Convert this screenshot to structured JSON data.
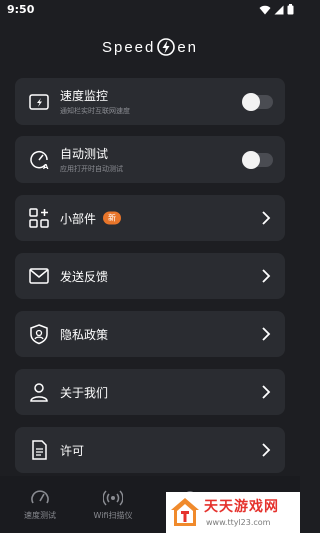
{
  "status_bar": {
    "time": "9:50"
  },
  "header": {
    "logo_left": "Speed",
    "logo_right": "en"
  },
  "settings": [
    {
      "title": "速度监控",
      "subtitle": "通知栏实时互联网速度",
      "control": "toggle",
      "on": false
    },
    {
      "title": "自动测试",
      "subtitle": "应用打开时自动测试",
      "control": "toggle",
      "on": false
    },
    {
      "title": "小部件",
      "badge": "新",
      "control": "chevron"
    },
    {
      "title": "发送反馈",
      "control": "chevron"
    },
    {
      "title": "隐私政策",
      "control": "chevron"
    },
    {
      "title": "关于我们",
      "control": "chevron"
    },
    {
      "title": "许可",
      "control": "chevron"
    }
  ],
  "bottom_nav": [
    {
      "label": "速度测试",
      "icon": "speedometer-icon"
    },
    {
      "label": "Wifi扫描仪",
      "icon": "wifi-scanner-icon"
    },
    {
      "label": "",
      "icon": "settings-icon"
    }
  ],
  "watermark": {
    "text": "天天游戏网",
    "url": "www.ttyl23.com"
  },
  "colors": {
    "background": "#1d1e22",
    "card": "#2a2c31",
    "accent": "#e8752a",
    "toggle_off": "#4a4c52"
  }
}
